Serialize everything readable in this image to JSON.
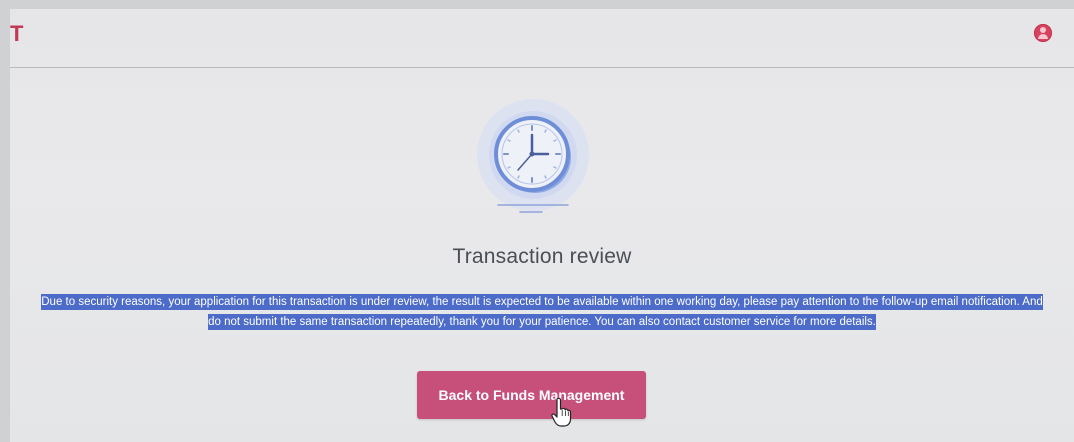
{
  "header": {
    "brand_mark": "T",
    "user_icon": "user-icon",
    "accent_color": "#c23a55"
  },
  "status": {
    "icon": "clock-icon",
    "title": "Transaction review",
    "message": "Due to security reasons, your application for this transaction is under review, the result is expected to be available within one working day, please pay attention to the follow-up email notification. And do not submit the same transaction repeatedly, thank you for your patience. You can also contact customer service for more details."
  },
  "actions": {
    "back_label": "Back to Funds Management",
    "button_color": "#c7507a"
  },
  "selection_color": "#4d6cc9"
}
